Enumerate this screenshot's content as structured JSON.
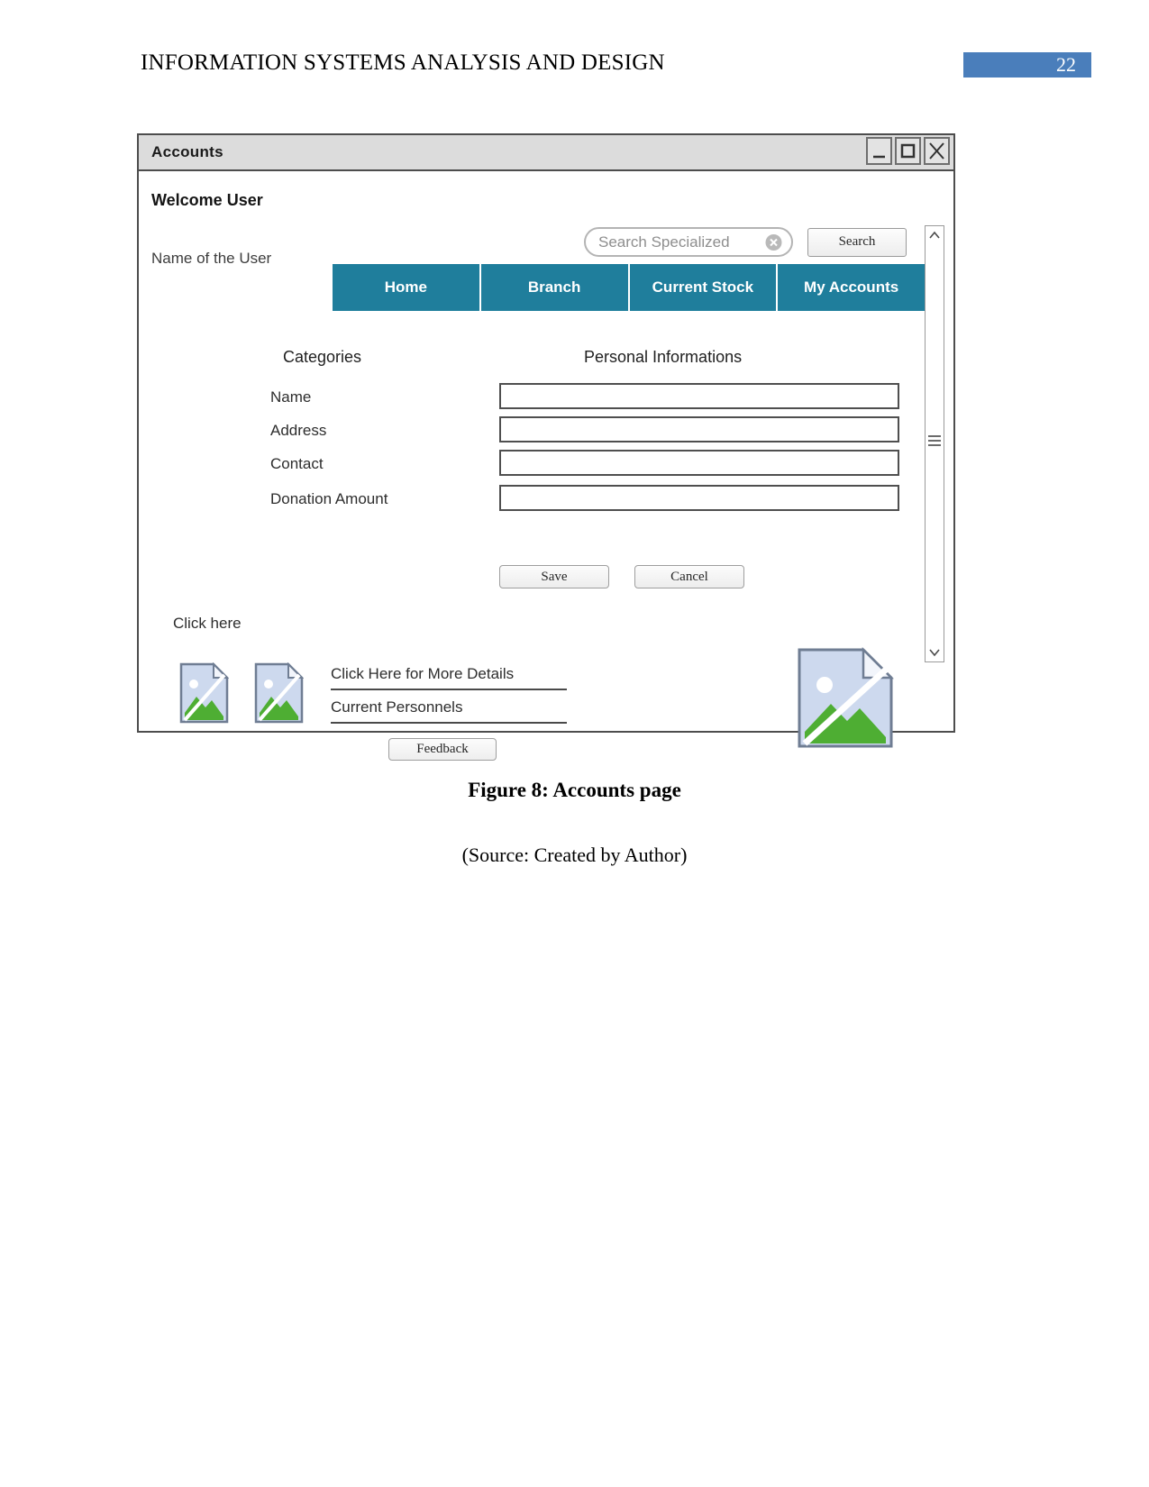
{
  "document": {
    "header_title": "INFORMATION SYSTEMS ANALYSIS AND DESIGN",
    "page_number": "22",
    "page_badge_color": "#4a7ebb",
    "figure_caption": "Figure 8: Accounts page",
    "figure_source": "(Source: Created by Author)"
  },
  "window": {
    "title": "Accounts",
    "controls": [
      {
        "name": "minimize",
        "icon": "minimize-icon"
      },
      {
        "name": "maximize",
        "icon": "maximize-icon"
      },
      {
        "name": "close",
        "icon": "close-icon"
      }
    ]
  },
  "header": {
    "welcome": "Welcome User",
    "user_name": "Name of the User"
  },
  "search": {
    "placeholder": "Search Specialized",
    "value": "",
    "clear_icon": "clear-circle-icon",
    "button_label": "Search"
  },
  "nav": {
    "accent_color": "#1f7e9c",
    "tabs": [
      {
        "label": "Home"
      },
      {
        "label": "Branch"
      },
      {
        "label": "Current Stock"
      },
      {
        "label": "My Accounts"
      }
    ]
  },
  "form": {
    "column_headers": {
      "left": "Categories",
      "right": "Personal Informations"
    },
    "fields": [
      {
        "label": "Name",
        "value": "",
        "placeholder": ""
      },
      {
        "label": "Address",
        "value": "",
        "placeholder": ""
      },
      {
        "label": "Contact",
        "value": "",
        "placeholder": ""
      },
      {
        "label": "Donation Amount",
        "value": "",
        "placeholder": ""
      }
    ],
    "actions": [
      {
        "label": "Save"
      },
      {
        "label": "Cancel"
      }
    ]
  },
  "footer": {
    "click_here": "Click here",
    "links": [
      {
        "label": "Click Here for More Details"
      },
      {
        "label": "Current Personnels"
      }
    ],
    "feedback_label": "Feedback",
    "images": [
      {
        "icon": "broken-image-icon"
      },
      {
        "icon": "broken-image-icon"
      },
      {
        "icon": "broken-image-icon"
      }
    ]
  },
  "scrollbar": {
    "up_arrow": "chevron-up-icon",
    "down_arrow": "chevron-down-icon",
    "thumb": "scrollbar-thumb"
  }
}
